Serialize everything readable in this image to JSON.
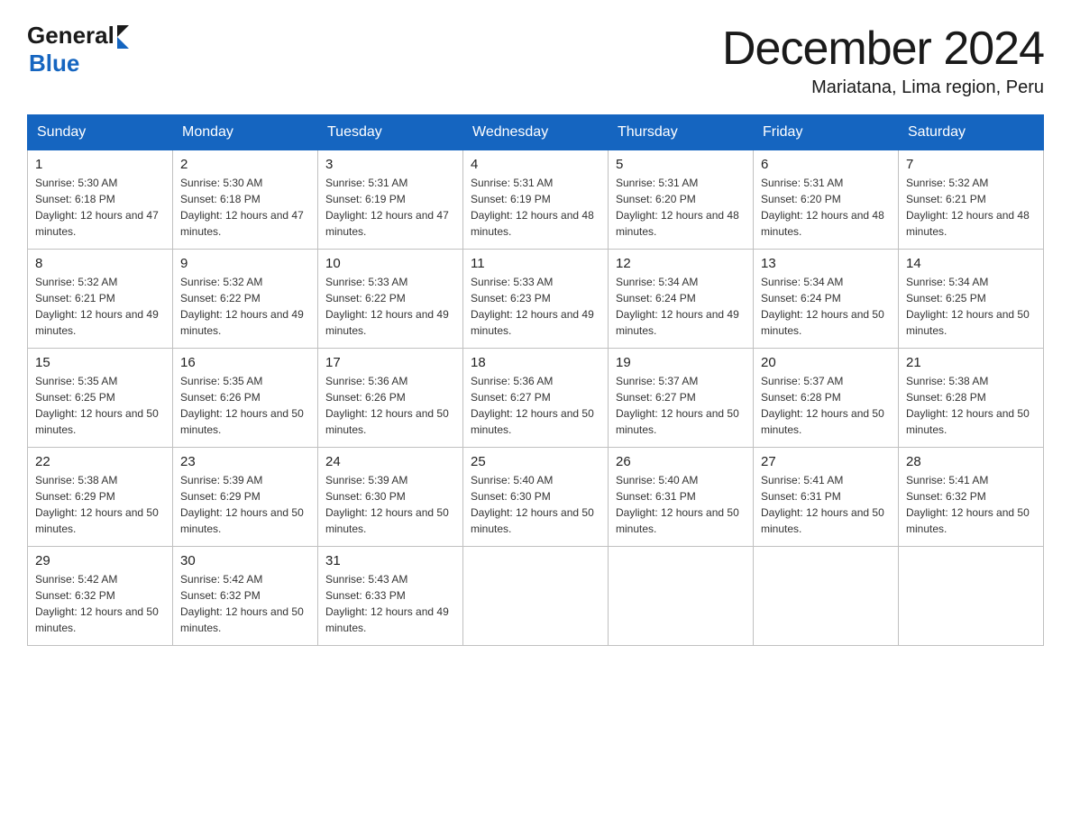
{
  "header": {
    "logo_general": "General",
    "logo_blue": "Blue",
    "month_title": "December 2024",
    "subtitle": "Mariatana, Lima region, Peru"
  },
  "days_of_week": [
    "Sunday",
    "Monday",
    "Tuesday",
    "Wednesday",
    "Thursday",
    "Friday",
    "Saturday"
  ],
  "weeks": [
    [
      {
        "num": "1",
        "sunrise": "5:30 AM",
        "sunset": "6:18 PM",
        "daylight": "12 hours and 47 minutes."
      },
      {
        "num": "2",
        "sunrise": "5:30 AM",
        "sunset": "6:18 PM",
        "daylight": "12 hours and 47 minutes."
      },
      {
        "num": "3",
        "sunrise": "5:31 AM",
        "sunset": "6:19 PM",
        "daylight": "12 hours and 47 minutes."
      },
      {
        "num": "4",
        "sunrise": "5:31 AM",
        "sunset": "6:19 PM",
        "daylight": "12 hours and 48 minutes."
      },
      {
        "num": "5",
        "sunrise": "5:31 AM",
        "sunset": "6:20 PM",
        "daylight": "12 hours and 48 minutes."
      },
      {
        "num": "6",
        "sunrise": "5:31 AM",
        "sunset": "6:20 PM",
        "daylight": "12 hours and 48 minutes."
      },
      {
        "num": "7",
        "sunrise": "5:32 AM",
        "sunset": "6:21 PM",
        "daylight": "12 hours and 48 minutes."
      }
    ],
    [
      {
        "num": "8",
        "sunrise": "5:32 AM",
        "sunset": "6:21 PM",
        "daylight": "12 hours and 49 minutes."
      },
      {
        "num": "9",
        "sunrise": "5:32 AM",
        "sunset": "6:22 PM",
        "daylight": "12 hours and 49 minutes."
      },
      {
        "num": "10",
        "sunrise": "5:33 AM",
        "sunset": "6:22 PM",
        "daylight": "12 hours and 49 minutes."
      },
      {
        "num": "11",
        "sunrise": "5:33 AM",
        "sunset": "6:23 PM",
        "daylight": "12 hours and 49 minutes."
      },
      {
        "num": "12",
        "sunrise": "5:34 AM",
        "sunset": "6:24 PM",
        "daylight": "12 hours and 49 minutes."
      },
      {
        "num": "13",
        "sunrise": "5:34 AM",
        "sunset": "6:24 PM",
        "daylight": "12 hours and 50 minutes."
      },
      {
        "num": "14",
        "sunrise": "5:34 AM",
        "sunset": "6:25 PM",
        "daylight": "12 hours and 50 minutes."
      }
    ],
    [
      {
        "num": "15",
        "sunrise": "5:35 AM",
        "sunset": "6:25 PM",
        "daylight": "12 hours and 50 minutes."
      },
      {
        "num": "16",
        "sunrise": "5:35 AM",
        "sunset": "6:26 PM",
        "daylight": "12 hours and 50 minutes."
      },
      {
        "num": "17",
        "sunrise": "5:36 AM",
        "sunset": "6:26 PM",
        "daylight": "12 hours and 50 minutes."
      },
      {
        "num": "18",
        "sunrise": "5:36 AM",
        "sunset": "6:27 PM",
        "daylight": "12 hours and 50 minutes."
      },
      {
        "num": "19",
        "sunrise": "5:37 AM",
        "sunset": "6:27 PM",
        "daylight": "12 hours and 50 minutes."
      },
      {
        "num": "20",
        "sunrise": "5:37 AM",
        "sunset": "6:28 PM",
        "daylight": "12 hours and 50 minutes."
      },
      {
        "num": "21",
        "sunrise": "5:38 AM",
        "sunset": "6:28 PM",
        "daylight": "12 hours and 50 minutes."
      }
    ],
    [
      {
        "num": "22",
        "sunrise": "5:38 AM",
        "sunset": "6:29 PM",
        "daylight": "12 hours and 50 minutes."
      },
      {
        "num": "23",
        "sunrise": "5:39 AM",
        "sunset": "6:29 PM",
        "daylight": "12 hours and 50 minutes."
      },
      {
        "num": "24",
        "sunrise": "5:39 AM",
        "sunset": "6:30 PM",
        "daylight": "12 hours and 50 minutes."
      },
      {
        "num": "25",
        "sunrise": "5:40 AM",
        "sunset": "6:30 PM",
        "daylight": "12 hours and 50 minutes."
      },
      {
        "num": "26",
        "sunrise": "5:40 AM",
        "sunset": "6:31 PM",
        "daylight": "12 hours and 50 minutes."
      },
      {
        "num": "27",
        "sunrise": "5:41 AM",
        "sunset": "6:31 PM",
        "daylight": "12 hours and 50 minutes."
      },
      {
        "num": "28",
        "sunrise": "5:41 AM",
        "sunset": "6:32 PM",
        "daylight": "12 hours and 50 minutes."
      }
    ],
    [
      {
        "num": "29",
        "sunrise": "5:42 AM",
        "sunset": "6:32 PM",
        "daylight": "12 hours and 50 minutes."
      },
      {
        "num": "30",
        "sunrise": "5:42 AM",
        "sunset": "6:32 PM",
        "daylight": "12 hours and 50 minutes."
      },
      {
        "num": "31",
        "sunrise": "5:43 AM",
        "sunset": "6:33 PM",
        "daylight": "12 hours and 49 minutes."
      },
      null,
      null,
      null,
      null
    ]
  ]
}
